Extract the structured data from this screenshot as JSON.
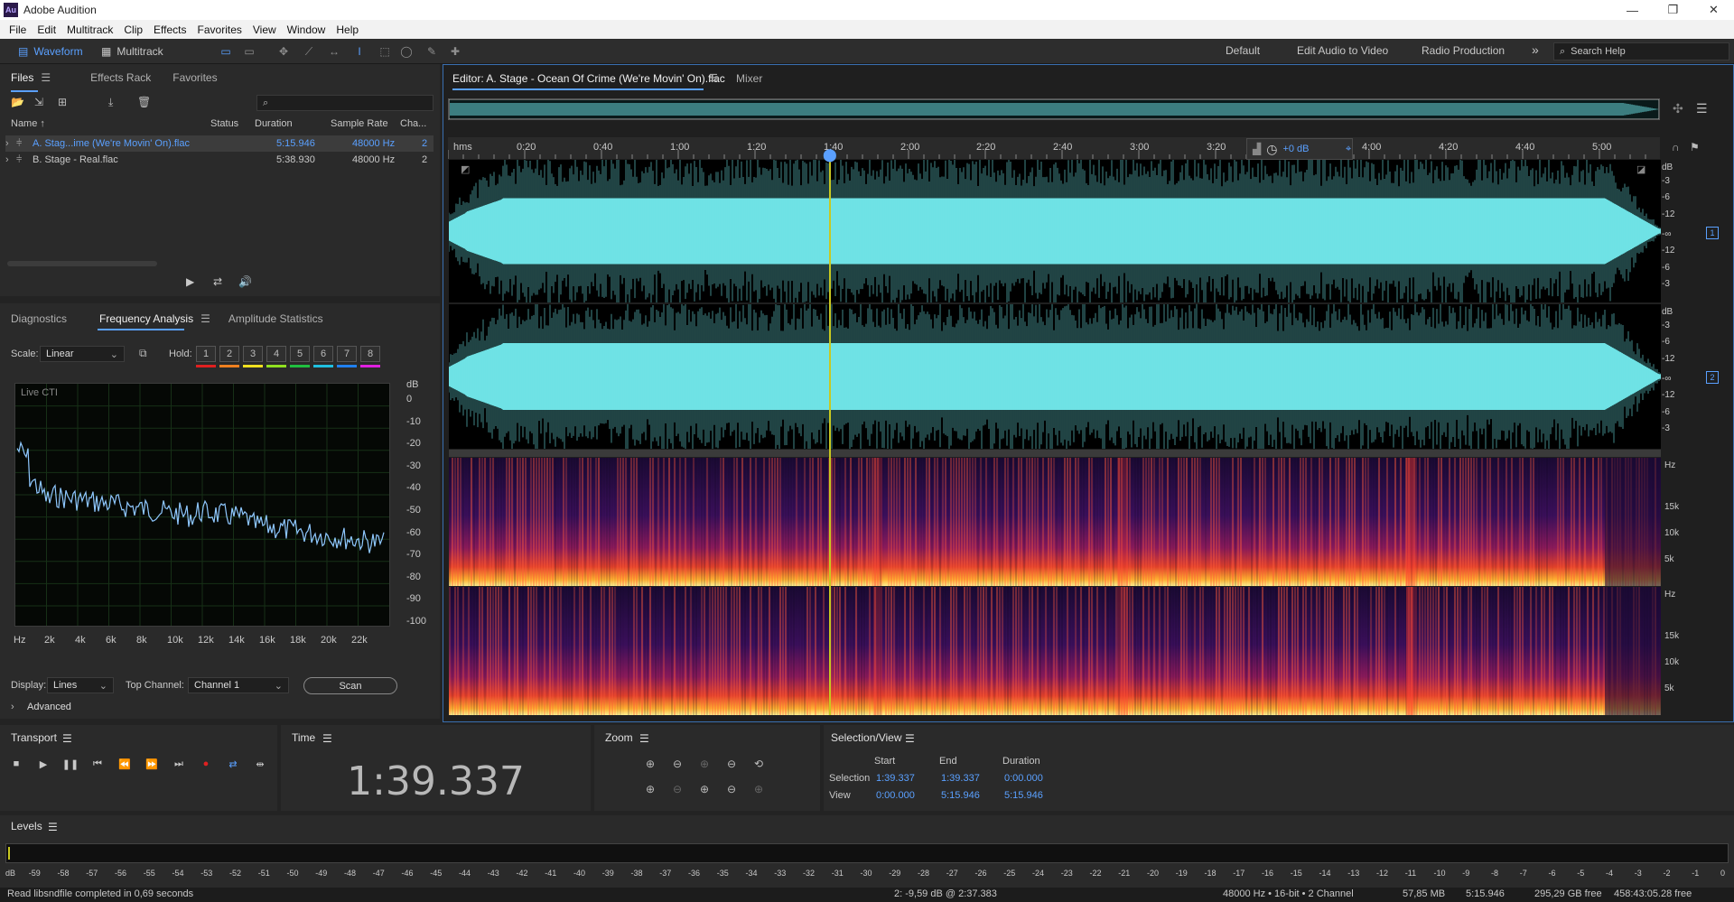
{
  "app": {
    "title": "Adobe Audition",
    "logo": "Au"
  },
  "menu": [
    "File",
    "Edit",
    "Multitrack",
    "Clip",
    "Effects",
    "Favorites",
    "View",
    "Window",
    "Help"
  ],
  "toolbar": {
    "waveform": "Waveform",
    "multitrack": "Multitrack",
    "workspaces": [
      "Default",
      "Edit Audio to Video",
      "Radio Production"
    ],
    "search_placeholder": "Search Help"
  },
  "files_panel": {
    "tabs": [
      "Files",
      "Effects Rack",
      "Favorites"
    ],
    "columns": [
      "Name ↑",
      "Status",
      "Duration",
      "Sample Rate",
      "Cha..."
    ],
    "rows": [
      {
        "name": "A. Stag...ime (We're Movin' On).flac",
        "status": "",
        "duration": "5:15.946",
        "rate": "48000 Hz",
        "ch": "2"
      },
      {
        "name": "B. Stage - Real.flac",
        "status": "",
        "duration": "5:38.930",
        "rate": "48000 Hz",
        "ch": "2"
      }
    ]
  },
  "analysis_panel": {
    "tabs": [
      "Diagnostics",
      "Frequency Analysis",
      "Amplitude Statistics"
    ],
    "scale_label": "Scale:",
    "scale_value": "Linear",
    "hold_label": "Hold:",
    "hold": [
      "1",
      "2",
      "3",
      "4",
      "5",
      "6",
      "7",
      "8"
    ],
    "hold_colors": [
      "#e02020",
      "#f08020",
      "#f0e020",
      "#90e020",
      "#20c040",
      "#20c0e0",
      "#2080f0",
      "#e020e0"
    ],
    "live_label": "Live CTI",
    "db_unit": "dB",
    "y_ticks": [
      "0",
      "-10",
      "-20",
      "-30",
      "-40",
      "-50",
      "-60",
      "-70",
      "-80",
      "-90",
      "-100"
    ],
    "x_ticks": [
      "Hz",
      "2k",
      "4k",
      "6k",
      "8k",
      "10k",
      "12k",
      "14k",
      "16k",
      "18k",
      "20k",
      "22k"
    ],
    "display_label": "Display:",
    "display_value": "Lines",
    "top_channel_label": "Top Channel:",
    "top_channel_value": "Channel 1",
    "scan": "Scan",
    "advanced": "Advanced"
  },
  "editor": {
    "tab_title": "Editor: A. Stage - Ocean Of Crime (We're Movin' On).flac",
    "mixer": "Mixer",
    "ruler": [
      "hms",
      "0:20",
      "0:40",
      "1:00",
      "1:20",
      "1:40",
      "2:00",
      "2:20",
      "2:40",
      "3:00",
      "3:20",
      "4:00",
      "4:20",
      "4:40",
      "5:00"
    ],
    "gain": "+0 dB",
    "db_scale": [
      "dB",
      "-3",
      "-6",
      "-12",
      "-∞",
      "-12",
      "-6",
      "-3"
    ],
    "hz_scale": [
      "Hz",
      "15k",
      "10k",
      "5k"
    ],
    "channels": [
      "1",
      "2"
    ]
  },
  "transport": {
    "title": "Transport"
  },
  "time": {
    "title": "Time",
    "value": "1:39.337"
  },
  "zoom": {
    "title": "Zoom"
  },
  "selection": {
    "title": "Selection/View",
    "headers": [
      "Start",
      "End",
      "Duration"
    ],
    "rows": [
      {
        "label": "Selection",
        "start": "1:39.337",
        "end": "1:39.337",
        "dur": "0:00.000"
      },
      {
        "label": "View",
        "start": "0:00.000",
        "end": "5:15.946",
        "dur": "5:15.946"
      }
    ]
  },
  "levels": {
    "title": "Levels",
    "ticks": [
      "dB",
      "-59",
      "-58",
      "-57",
      "-56",
      "-55",
      "-54",
      "-53",
      "-52",
      "-51",
      "-50",
      "-49",
      "-48",
      "-47",
      "-46",
      "-45",
      "-44",
      "-43",
      "-42",
      "-41",
      "-40",
      "-39",
      "-38",
      "-37",
      "-36",
      "-35",
      "-34",
      "-33",
      "-32",
      "-31",
      "-30",
      "-29",
      "-28",
      "-27",
      "-26",
      "-25",
      "-24",
      "-23",
      "-22",
      "-21",
      "-20",
      "-19",
      "-18",
      "-17",
      "-16",
      "-15",
      "-14",
      "-13",
      "-12",
      "-11",
      "-10",
      "-9",
      "-8",
      "-7",
      "-6",
      "-5",
      "-4",
      "-3",
      "-2",
      "-1",
      "0"
    ]
  },
  "status": {
    "left": "Read libsndfile completed in 0,69 seconds",
    "cursor": "2: -9,59 dB @ 2:37.383",
    "format": "48000 Hz • 16-bit • 2 Channel",
    "size": "57,85 MB",
    "duration": "5:15.946",
    "free": "295,29 GB free",
    "time_free": "458:43:05.28 free"
  },
  "colors": {
    "accent": "#5aa0ff",
    "wave": "#6fe3e5",
    "playhead": "#e8e020"
  }
}
